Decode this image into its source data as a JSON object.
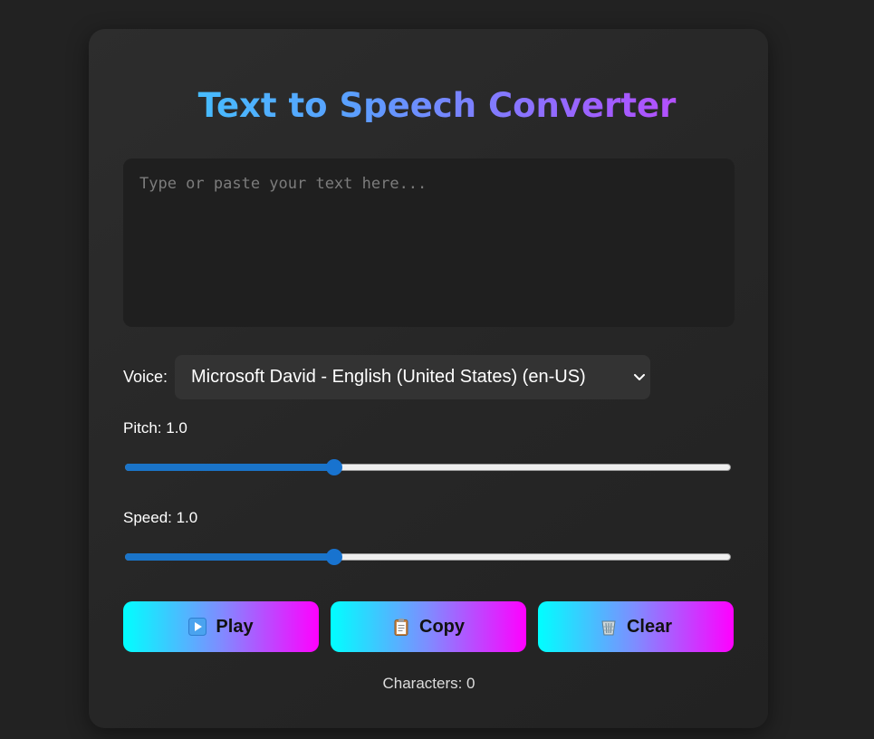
{
  "app": {
    "title": "Text to Speech Converter"
  },
  "input": {
    "placeholder": "Type or paste your text here...",
    "value": ""
  },
  "voice": {
    "label": "Voice:",
    "selected": "Microsoft David - English (United States) (en-US)"
  },
  "pitch": {
    "label_text": "Pitch: 1.0",
    "value": 1.0,
    "fraction": 0.345
  },
  "speed": {
    "label_text": "Speed: 1.0",
    "value": 1.0,
    "fraction": 0.345
  },
  "buttons": {
    "play": {
      "label": "Play",
      "icon": "play-icon"
    },
    "copy": {
      "label": "Copy",
      "icon": "clipboard-icon"
    },
    "clear": {
      "label": "Clear",
      "icon": "trash-icon"
    }
  },
  "footer": {
    "char_count": "Characters: 0"
  },
  "colors": {
    "background": "#222222",
    "card": "#2a2a2a",
    "button_gradient_start": "#00ffff",
    "button_gradient_end": "#ff00ff",
    "slider_accent": "#1873cf"
  }
}
